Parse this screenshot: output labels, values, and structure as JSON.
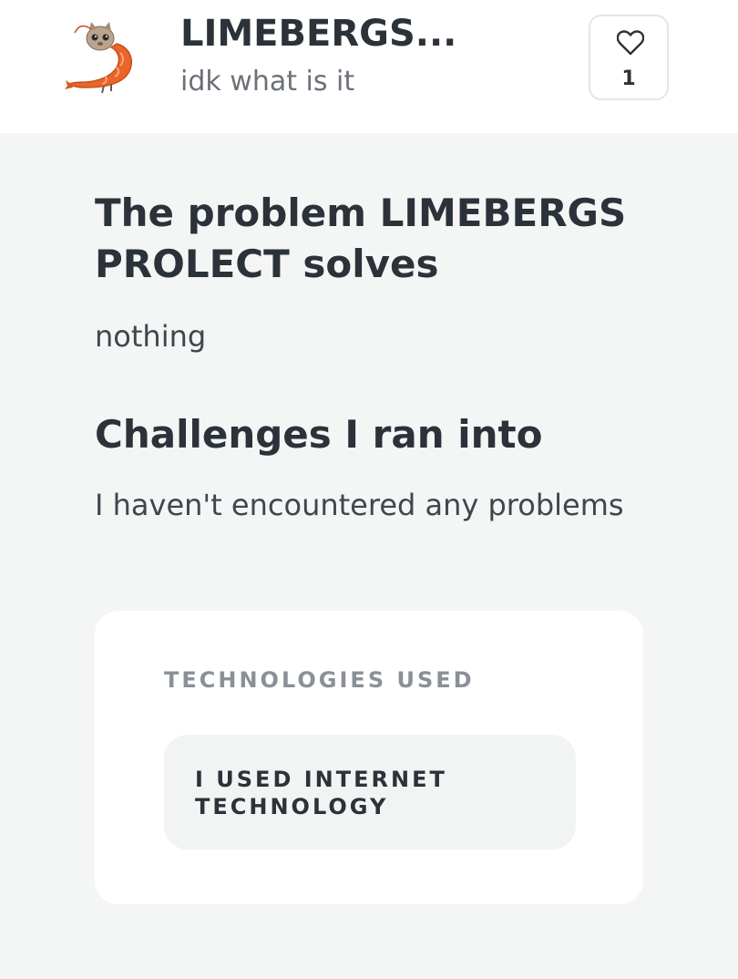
{
  "header": {
    "title": "LIMEBERGS...",
    "tagline": "idk what is it",
    "logo_icon": "shrimp-logo-icon",
    "like": {
      "icon": "heart-icon",
      "count": "1"
    }
  },
  "sections": [
    {
      "heading": "The problem LIMEBERGS PROLECT solves",
      "body": "nothing"
    },
    {
      "heading": "Challenges I ran into",
      "body": "I haven't encountered any problems"
    }
  ],
  "technologies": {
    "label": "TECHNOLOGIES USED",
    "items": [
      "I USED INTERNET TECHNOLOGY"
    ]
  },
  "colors": {
    "page_background": "#f4f5f5",
    "header_background": "#ffffff",
    "text_primary": "#2c3239",
    "text_muted": "#6b7178",
    "logo_orange": "#e9652a"
  }
}
